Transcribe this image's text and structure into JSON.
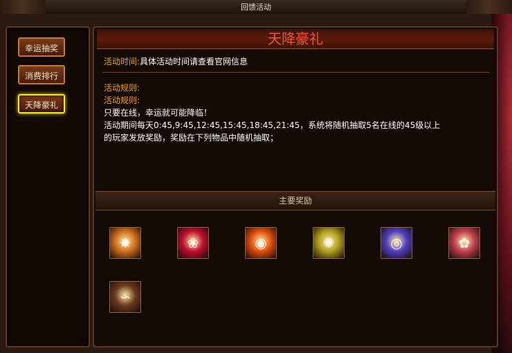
{
  "window": {
    "title": "回馈活动"
  },
  "sidebar": {
    "items": [
      {
        "label": "幸运抽奖",
        "active": false
      },
      {
        "label": "消费排行",
        "active": false
      },
      {
        "label": "天降豪礼",
        "active": true
      }
    ]
  },
  "main": {
    "title": "天降豪礼",
    "time_label": "活动时间:",
    "time_value": "具体活动时间请查看官网信息",
    "rules_label_1": "活动规则:",
    "rules_label_2": "活动规则:",
    "rules_line_1": "只要在线，幸运就可能降临！",
    "rules_line_2": "活动期间每天0:45,9:45,12:45,15:45,18:45,21:45，系统将随机抽取5名在线的45级以上",
    "rules_line_3": "的玩家发放奖励，奖励在下列物品中随机抽取；",
    "rewards_header": "主要奖励"
  },
  "rewards": [
    {
      "icon": "star-burst-icon",
      "color": "#d07020"
    },
    {
      "icon": "red-rose-icon",
      "color": "#c01030"
    },
    {
      "icon": "fire-orb-icon",
      "color": "#e05010"
    },
    {
      "icon": "golden-orb-icon",
      "color": "#b0a020"
    },
    {
      "icon": "blue-eye-icon",
      "color": "#5040c0"
    },
    {
      "icon": "pink-rose-icon",
      "color": "#c04050"
    },
    {
      "icon": "whip-icon",
      "color": "#6a3a20"
    }
  ]
}
